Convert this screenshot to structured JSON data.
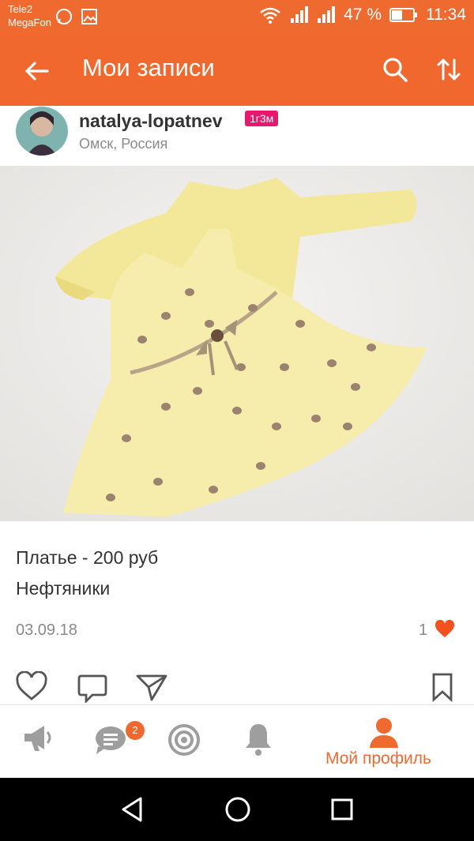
{
  "status_bar": {
    "carrier_1": "Tele2",
    "carrier_2": "MegaFon",
    "battery": "47 %",
    "time": "11:34"
  },
  "app_bar": {
    "title": "Мои записи"
  },
  "post": {
    "author": "natalya-lopatnev",
    "badge": "1г3м",
    "location": "Омск, Россия",
    "text_line_1": "Платье - 200 руб",
    "text_line_2": "Нефтяники",
    "date": "03.09.18",
    "likes": "1"
  },
  "bottom_nav": {
    "messages_badge": "2",
    "profile_label": "Мой профиль"
  },
  "colors": {
    "accent": "#ee6a2f",
    "badge": "#e8186f",
    "like": "#f4511e"
  },
  "icons": [
    "back-arrow-icon",
    "search-icon",
    "sort-icon",
    "heart-icon",
    "comment-icon",
    "send-icon",
    "bookmark-icon",
    "megaphone-icon",
    "chat-icon",
    "target-icon",
    "bell-icon",
    "person-icon"
  ]
}
